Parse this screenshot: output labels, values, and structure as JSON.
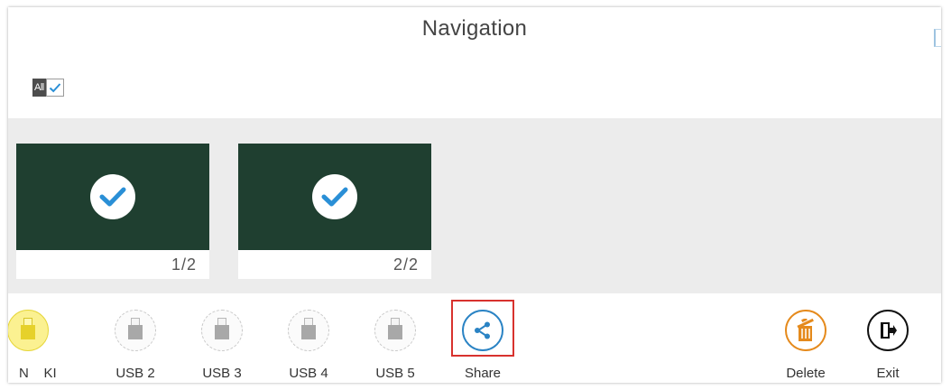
{
  "header": {
    "title": "Navigation"
  },
  "select_all": {
    "label": "All",
    "checked": true
  },
  "pages": [
    {
      "number": "1/2",
      "selected": true
    },
    {
      "number": "2/2",
      "selected": true
    }
  ],
  "toolbar": {
    "usb_truncated": {
      "label": "N    KI",
      "icon": "usb-icon",
      "active": true
    },
    "usb2": {
      "label": "USB 2",
      "icon": "usb-icon"
    },
    "usb3": {
      "label": "USB 3",
      "icon": "usb-icon"
    },
    "usb4": {
      "label": "USB 4",
      "icon": "usb-icon"
    },
    "usb5": {
      "label": "USB 5",
      "icon": "usb-icon"
    },
    "share": {
      "label": "Share",
      "icon": "share-icon",
      "highlighted": true
    },
    "delete": {
      "label": "Delete",
      "icon": "trash-icon"
    },
    "exit": {
      "label": "Exit",
      "icon": "exit-door-icon"
    }
  },
  "colors": {
    "thumbnail": "#1f3f30",
    "check": "#2a8fd6",
    "share_accent": "#2a83c4",
    "delete_accent": "#e58a1c",
    "highlight_box": "#d8322e",
    "usb_active": "#fbf191"
  }
}
